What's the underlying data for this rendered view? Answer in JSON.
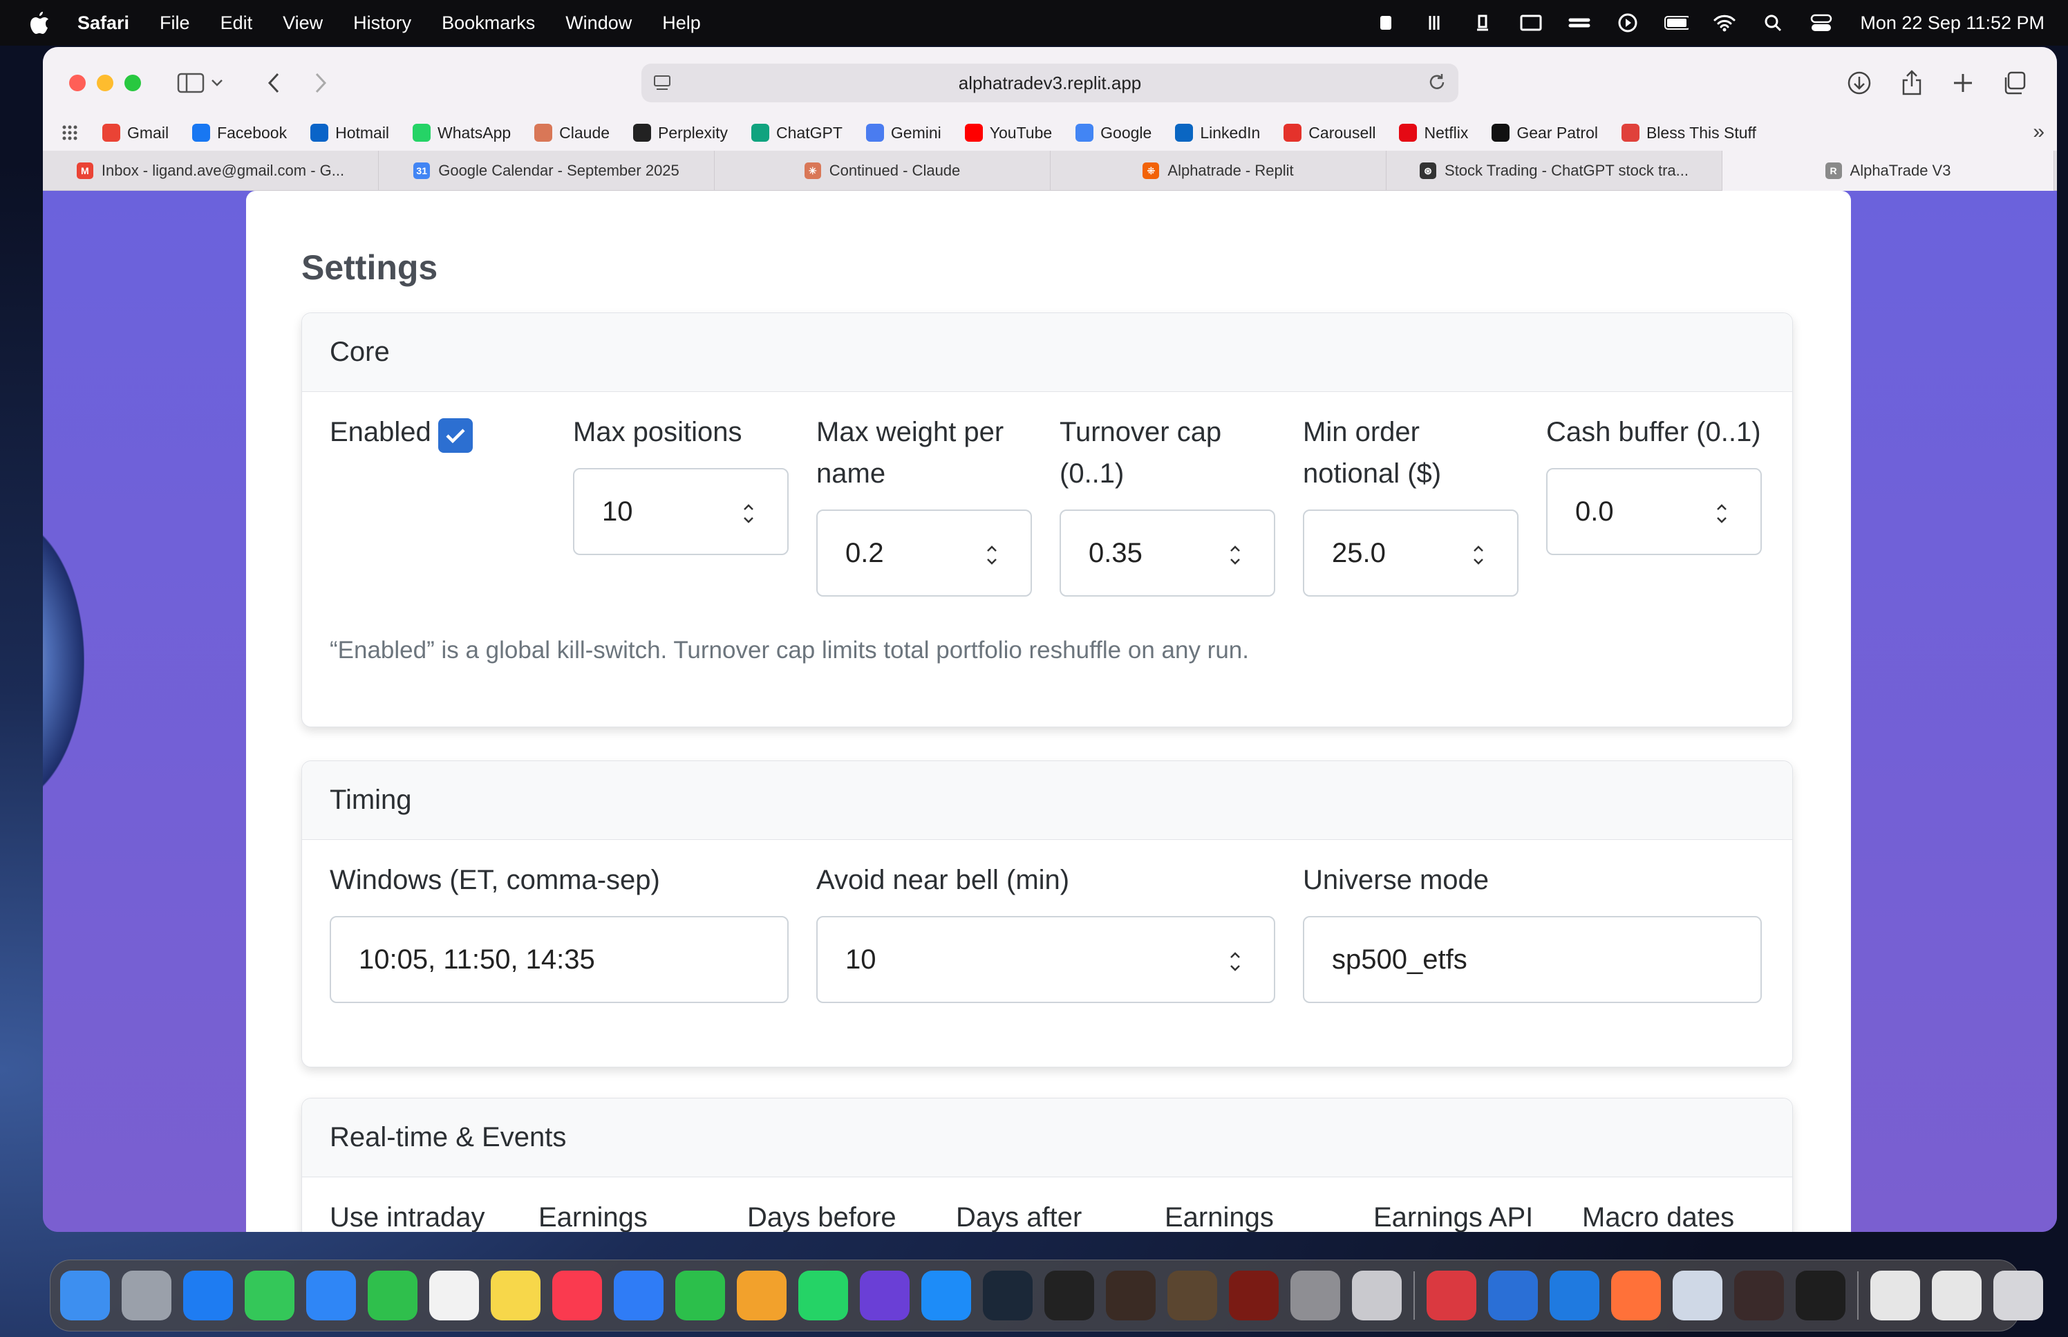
{
  "menubar": {
    "app": "Safari",
    "items": [
      "File",
      "Edit",
      "View",
      "History",
      "Bookmarks",
      "Window",
      "Help"
    ],
    "datetime": "Mon 22 Sep  11:52 PM"
  },
  "browser": {
    "url": "alphatradev3.replit.app",
    "bookmarks": [
      {
        "label": "Gmail",
        "color": "#ea4335"
      },
      {
        "label": "Facebook",
        "color": "#1877f2"
      },
      {
        "label": "Hotmail",
        "color": "#0a64c8"
      },
      {
        "label": "WhatsApp",
        "color": "#25d366"
      },
      {
        "label": "Claude",
        "color": "#d97757"
      },
      {
        "label": "Perplexity",
        "color": "#222222"
      },
      {
        "label": "ChatGPT",
        "color": "#10a37f"
      },
      {
        "label": "Gemini",
        "color": "#4a7cf0"
      },
      {
        "label": "YouTube",
        "color": "#ff0000"
      },
      {
        "label": "Google",
        "color": "#4285f4"
      },
      {
        "label": "LinkedIn",
        "color": "#0a66c2"
      },
      {
        "label": "Carousell",
        "color": "#e4322b"
      },
      {
        "label": "Netflix",
        "color": "#e50914"
      },
      {
        "label": "Gear Patrol",
        "color": "#111111"
      },
      {
        "label": "Bless This Stuff",
        "color": "#e0413b"
      }
    ],
    "tabs": [
      {
        "label": "Inbox - ligand.ave@gmail.com - G...",
        "color": "#ea4335",
        "glyph": "M"
      },
      {
        "label": "Google Calendar - September 2025",
        "color": "#4285f4",
        "glyph": "31"
      },
      {
        "label": "Continued - Claude",
        "color": "#d97757",
        "glyph": "✳"
      },
      {
        "label": "Alphatrade - Replit",
        "color": "#f26207",
        "glyph": "⁜"
      },
      {
        "label": "Stock Trading - ChatGPT stock tra...",
        "color": "#333333",
        "glyph": "⊛"
      },
      {
        "label": "AlphaTrade V3",
        "color": "#8a8a8a",
        "glyph": "R"
      }
    ]
  },
  "page": {
    "title": "Settings",
    "core": {
      "heading": "Core",
      "enabled_label": "Enabled",
      "enabled": true,
      "max_positions_label": "Max positions",
      "max_positions": "10",
      "max_weight_label": "Max weight per name",
      "max_weight": "0.2",
      "turnover_label": "Turnover cap (0..1)",
      "turnover": "0.35",
      "min_order_label": "Min order notional ($)",
      "min_order": "25.0",
      "cash_buffer_label": "Cash buffer (0..1)",
      "cash_buffer": "0.0",
      "help": "“Enabled” is a global kill-switch. Turnover cap limits total portfolio reshuffle on any run."
    },
    "timing": {
      "heading": "Timing",
      "windows_label": "Windows (ET, comma-sep)",
      "windows": "10:05, 11:50, 14:35",
      "avoid_bell_label": "Avoid near bell (min)",
      "avoid_bell": "10",
      "universe_label": "Universe mode",
      "universe": "sp500_etfs"
    },
    "realtime": {
      "heading": "Real-time & Events",
      "cols": [
        "Use intraday",
        "Earnings",
        "Days before",
        "Days after",
        "Earnings",
        "Earnings API",
        "Macro dates"
      ]
    }
  },
  "dock": [
    {
      "name": "finder",
      "color": "#3d8ff0"
    },
    {
      "name": "launchpad",
      "color": "#9aa0aa"
    },
    {
      "name": "safari",
      "color": "#1e7cf2"
    },
    {
      "name": "messages",
      "color": "#34c759"
    },
    {
      "name": "mail",
      "color": "#2f86f6"
    },
    {
      "name": "facetime",
      "color": "#2fbf4c"
    },
    {
      "name": "photos",
      "color": "#f2f2f2"
    },
    {
      "name": "notes",
      "color": "#f7d74a"
    },
    {
      "name": "music",
      "color": "#fa3a4f"
    },
    {
      "name": "keynote",
      "color": "#2f7cf6"
    },
    {
      "name": "numbers",
      "color": "#2cbf4b"
    },
    {
      "name": "pages",
      "color": "#f2a12c"
    },
    {
      "name": "whatsapp",
      "color": "#25d366"
    },
    {
      "name": "imovie",
      "color": "#6a3fd6"
    },
    {
      "name": "app-store",
      "color": "#1d8cf8"
    },
    {
      "name": "steam",
      "color": "#1b2838"
    },
    {
      "name": "screenshot",
      "color": "#222222"
    },
    {
      "name": "vectorworks",
      "color": "#3a2b24"
    },
    {
      "name": "shogun",
      "color": "#5b4630"
    },
    {
      "name": "rome",
      "color": "#7a1b14"
    },
    {
      "name": "system-settings",
      "color": "#8e8e93"
    },
    {
      "name": "iphone-mirroring",
      "color": "#c9c9ce"
    },
    {
      "name": "expressvpn",
      "color": "#da3940"
    },
    {
      "name": "remote-desktop",
      "color": "#2a6fd6"
    },
    {
      "name": "windows-app",
      "color": "#1f7ae0"
    },
    {
      "name": "firefox",
      "color": "#ff7139"
    },
    {
      "name": "preview",
      "color": "#cfd8e6"
    },
    {
      "name": "unknown-app",
      "color": "#3a2a2a"
    },
    {
      "name": "cursor",
      "color": "#1e1e1e"
    },
    {
      "name": "recent-item-1",
      "color": "#e6e6e6"
    },
    {
      "name": "recent-item-2",
      "color": "#e6e6e6"
    },
    {
      "name": "trash",
      "color": "#d6d6da"
    }
  ]
}
